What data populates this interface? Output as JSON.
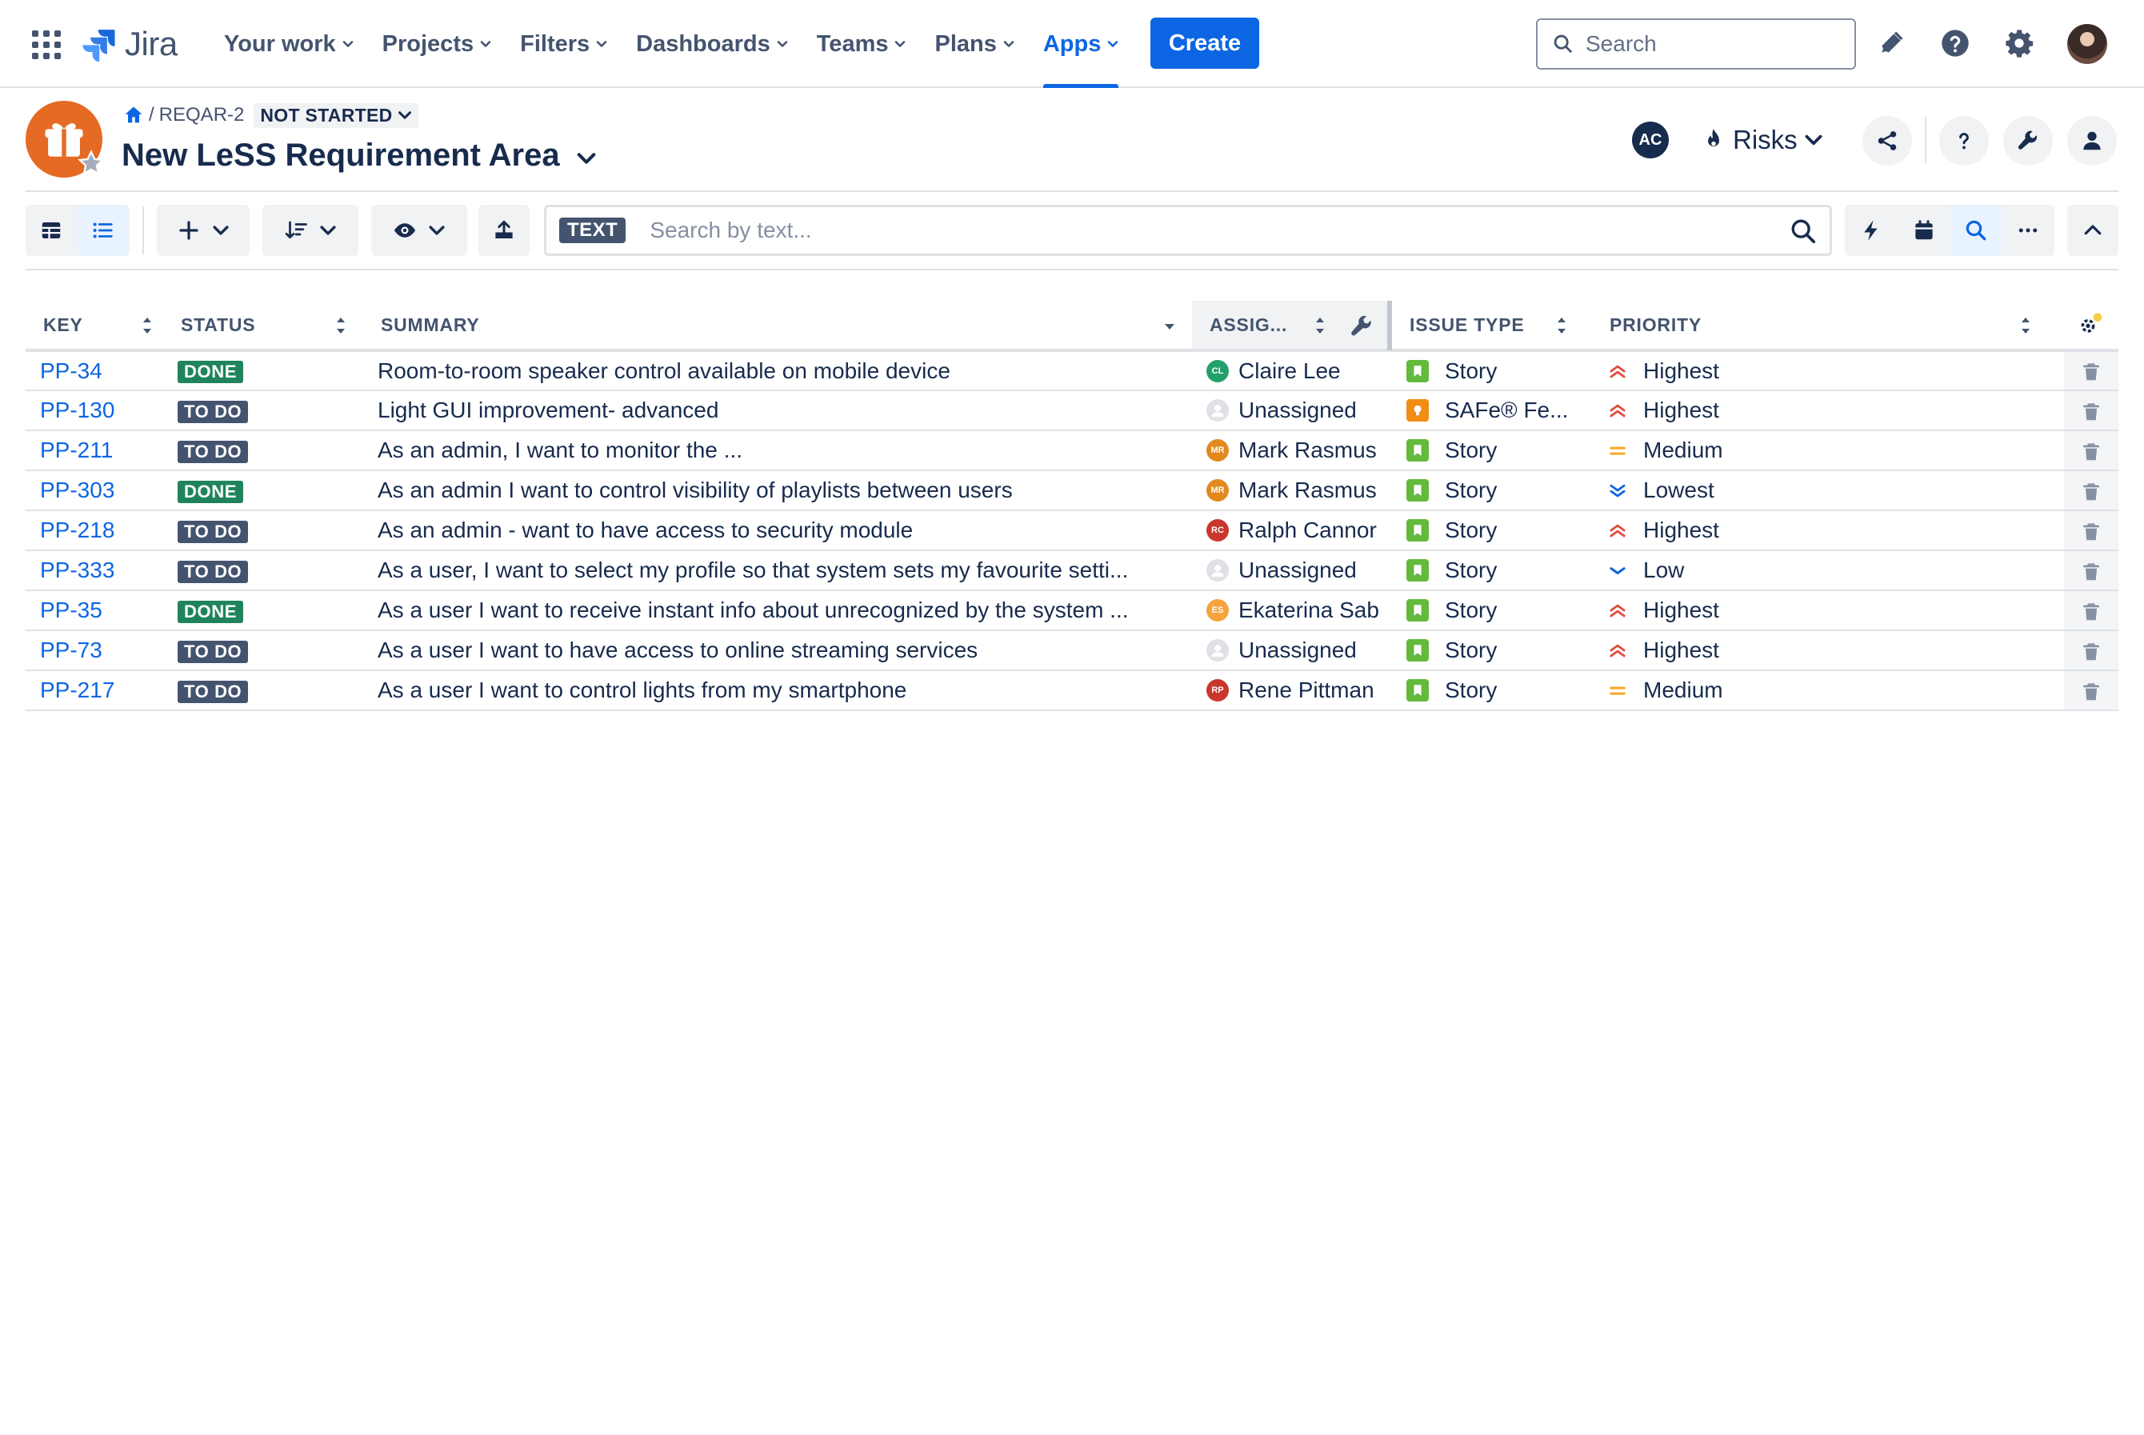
{
  "nav": {
    "logo_text": "Jira",
    "items": [
      {
        "label": "Your work"
      },
      {
        "label": "Projects"
      },
      {
        "label": "Filters"
      },
      {
        "label": "Dashboards"
      },
      {
        "label": "Teams"
      },
      {
        "label": "Plans"
      },
      {
        "label": "Apps"
      }
    ],
    "active_item": "Apps",
    "create_label": "Create",
    "search_placeholder": "Search"
  },
  "header": {
    "breadcrumb_key": "REQAR-2",
    "status": "NOT STARTED",
    "title": "New LeSS Requirement Area",
    "assignee_initials": "AC",
    "risks_label": "Risks"
  },
  "toolbar": {
    "text_tag": "TEXT",
    "search_placeholder": "Search by text..."
  },
  "table": {
    "columns": {
      "key": "KEY",
      "status": "STATUS",
      "summary": "SUMMARY",
      "assignee": "ASSIG...",
      "issue_type": "ISSUE TYPE",
      "priority": "PRIORITY"
    },
    "rows": [
      {
        "key": "PP-34",
        "status": "DONE",
        "summary": "Room-to-room speaker control available on mobile device",
        "assignee": "Claire Lee",
        "assignee_initials": "CL",
        "assignee_color": "#22a06b",
        "issue_type": "Story",
        "priority": "Highest"
      },
      {
        "key": "PP-130",
        "status": "TO DO",
        "summary": "Light GUI improvement- advanced",
        "assignee": "Unassigned",
        "assignee_initials": "",
        "assignee_color": "#dfe1e6",
        "issue_type": "SAFe® Fe...",
        "priority": "Highest"
      },
      {
        "key": "PP-211",
        "status": "TO DO",
        "summary": "As an admin, I want to monitor the ...",
        "assignee": "Mark Rasmus",
        "assignee_initials": "MR",
        "assignee_color": "#e2891d",
        "issue_type": "Story",
        "priority": "Medium"
      },
      {
        "key": "PP-303",
        "status": "DONE",
        "summary": "As an admin I want to control visibility of playlists between users",
        "assignee": "Mark Rasmus",
        "assignee_initials": "MR",
        "assignee_color": "#e2891d",
        "issue_type": "Story",
        "priority": "Lowest"
      },
      {
        "key": "PP-218",
        "status": "TO DO",
        "summary": "As an admin - want to have access to security module",
        "assignee": "Ralph Cannor",
        "assignee_initials": "RC",
        "assignee_color": "#c9372c",
        "issue_type": "Story",
        "priority": "Highest"
      },
      {
        "key": "PP-333",
        "status": "TO DO",
        "summary": "As a user, I want to select my profile so that system sets my favourite setti...",
        "assignee": "Unassigned",
        "assignee_initials": "",
        "assignee_color": "#dfe1e6",
        "issue_type": "Story",
        "priority": "Low"
      },
      {
        "key": "PP-35",
        "status": "DONE",
        "summary": "As a user I want to receive instant info about unrecognized by the system ...",
        "assignee": "Ekaterina Sab",
        "assignee_initials": "ES",
        "assignee_color": "#f5a33b",
        "issue_type": "Story",
        "priority": "Highest"
      },
      {
        "key": "PP-73",
        "status": "TO DO",
        "summary": "As a user I want to have access to online streaming services",
        "assignee": "Unassigned",
        "assignee_initials": "",
        "assignee_color": "#dfe1e6",
        "issue_type": "Story",
        "priority": "Highest"
      },
      {
        "key": "PP-217",
        "status": "TO DO",
        "summary": "As a user I want to control lights from my smartphone",
        "assignee": "Rene Pittman",
        "assignee_initials": "RP",
        "assignee_color": "#c9372c",
        "issue_type": "Story",
        "priority": "Medium"
      }
    ]
  },
  "colors": {
    "brand_blue": "#0c66e4",
    "done_green": "#1f845a",
    "todo_gray": "#44546f",
    "story_green": "#63ba3c",
    "feature_orange": "#f18d13",
    "priority_high": "#e2483d",
    "priority_medium": "#f5a623",
    "priority_low": "#0c66e4"
  }
}
